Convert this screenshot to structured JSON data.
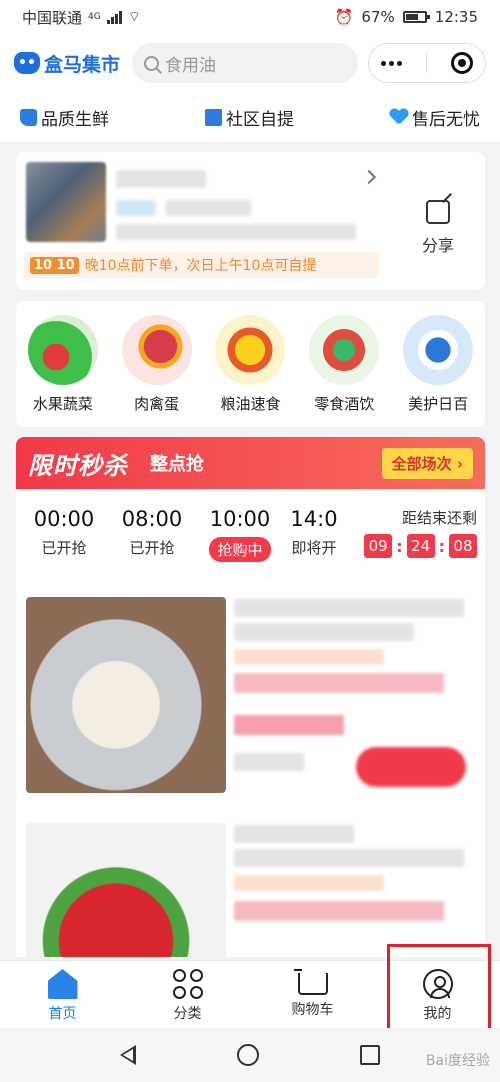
{
  "status": {
    "carrier": "中国联通",
    "network": "4G",
    "battery": "67%",
    "time": "12:35"
  },
  "header": {
    "logo": "盒马集市",
    "search_placeholder": "食用油"
  },
  "features": [
    "品质生鲜",
    "社区自提",
    "售后无忧"
  ],
  "store": {
    "promo_badge": "10 10",
    "promo_text": "晚10点前下单，次日上午10点可自提",
    "share_label": "分享"
  },
  "categories": [
    {
      "label": "水果蔬菜",
      "icon": "fruit-veg-image"
    },
    {
      "label": "肉禽蛋",
      "icon": "meat-egg-image"
    },
    {
      "label": "粮油速食",
      "icon": "grain-oil-image"
    },
    {
      "label": "零食酒饮",
      "icon": "snack-drink-image"
    },
    {
      "label": "美护日百",
      "icon": "beauty-daily-image"
    }
  ],
  "flash_sale": {
    "title": "限时秒杀",
    "subtitle": "整点抢",
    "all_label": "全部场次 ›",
    "slots": [
      {
        "time": "00:00",
        "label": "已开抢"
      },
      {
        "time": "08:00",
        "label": "已开抢"
      },
      {
        "time": "10:00",
        "label": "抢购中"
      },
      {
        "time": "14:0",
        "label": "即将开"
      }
    ],
    "countdown_label": "距结束还剩",
    "countdown": [
      "09",
      "24",
      "08"
    ]
  },
  "tabbar": [
    "首页",
    "分类",
    "购物车",
    "我的"
  ],
  "watermark": "Bai度经验",
  "colors": {
    "brand": "#1e6fd9",
    "sale_red": "#f23a4a",
    "highlight": "#d9262c"
  }
}
